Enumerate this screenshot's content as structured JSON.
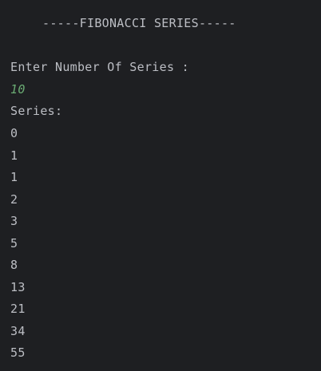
{
  "console": {
    "header": "-----FIBONACCI SERIES-----",
    "prompt": "Enter Number Of Series :",
    "input_value": "10",
    "series_label": "Series:",
    "series_values": [
      "0",
      "1",
      "1",
      "2",
      "3",
      "5",
      "8",
      "13",
      "21",
      "34",
      "55"
    ]
  },
  "colors": {
    "background": "#1e1f22",
    "text": "#bcbec4",
    "user_input": "#6aab73"
  }
}
